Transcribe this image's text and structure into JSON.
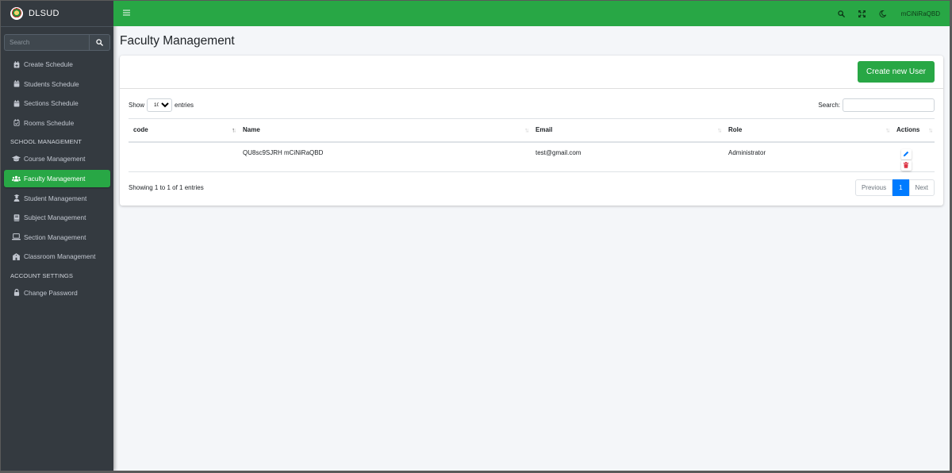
{
  "brand": {
    "name": "DLSUD"
  },
  "sidebar": {
    "search_placeholder": "Search",
    "schedule_items": [
      {
        "label": "Create Schedule",
        "icon": "calendar-plus-icon"
      },
      {
        "label": "Students Schedule",
        "icon": "calendar-icon"
      },
      {
        "label": "Sections Schedule",
        "icon": "calendar-icon"
      },
      {
        "label": "Rooms Schedule",
        "icon": "calendar-check-icon"
      }
    ],
    "school_header": "SCHOOL MANAGEMENT",
    "school_items": [
      {
        "label": "Course Management",
        "icon": "graduation-cap-icon"
      },
      {
        "label": "Faculty Management",
        "icon": "users-icon",
        "active": true
      },
      {
        "label": "Student Management",
        "icon": "user-graduate-icon"
      },
      {
        "label": "Subject Management",
        "icon": "book-icon"
      },
      {
        "label": "Section Management",
        "icon": "laptop-icon"
      },
      {
        "label": "Classroom Management",
        "icon": "school-icon"
      }
    ],
    "account_header": "ACCOUNT SETTINGS",
    "account_items": [
      {
        "label": "Change Password",
        "icon": "lock-icon"
      }
    ]
  },
  "topbar": {
    "menu_icon": "bars-icon",
    "user_name": "mCiNiRaQBD",
    "icons": [
      "search-icon",
      "expand-icon",
      "moon-icon"
    ]
  },
  "page": {
    "title": "Faculty Management"
  },
  "card": {
    "create_label": "Create new User"
  },
  "table_controls": {
    "show_label": "Show",
    "entries_value": "10",
    "entries_label": "entries",
    "search_label": "Search:",
    "info": "Showing 1 to 1 of 1 entries",
    "previous": "Previous",
    "current_page": "1",
    "next": "Next"
  },
  "table": {
    "columns": [
      "code",
      "Name",
      "Email",
      "Role",
      "Actions"
    ],
    "rows": [
      {
        "code": "",
        "name": "QU8sc9SJRH mCiNiRaQBD",
        "email": "test@gmail.com",
        "role": "Administrator"
      }
    ]
  },
  "colors": {
    "accent": "#28a745",
    "sidebar": "#343a40",
    "page_active": "#007bff",
    "edit": "#007bff",
    "delete": "#dc3545"
  }
}
